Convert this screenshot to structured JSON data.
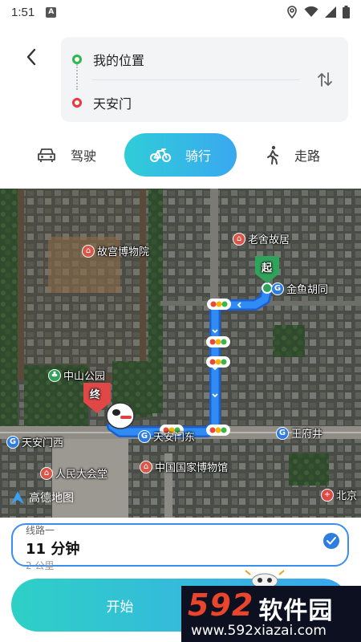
{
  "status_bar": {
    "time": "1:51",
    "notification_icon": "A",
    "icons": [
      "location-icon",
      "wifi-icon",
      "cellular-icon",
      "battery-icon"
    ]
  },
  "route": {
    "origin": "我的位置",
    "destination": "天安门"
  },
  "modes": [
    {
      "label": "驾驶",
      "icon": "car-icon",
      "selected": false
    },
    {
      "label": "骑行",
      "icon": "bicycle-icon",
      "selected": true
    },
    {
      "label": "走路",
      "icon": "walk-icon",
      "selected": false
    }
  ],
  "map": {
    "pois": [
      "故宫博物院",
      "老舍故居",
      "金鱼胡同",
      "中山公园",
      "天安门东",
      "王府井",
      "天安门西",
      "人民大会堂",
      "中国国家博物馆",
      "北京"
    ],
    "start_marker": "起",
    "end_marker": "终",
    "logo": "高德地图",
    "route_color": "#2f7de0"
  },
  "route_option": {
    "name": "线路一",
    "duration": "11 分钟",
    "distance": "2 公里",
    "selected": true
  },
  "start_button": {
    "label": "开始"
  },
  "watermark": {
    "brand_num": "592",
    "brand_text": "软件园",
    "url": "www.592xiazai.com"
  },
  "colors": {
    "accent_gradient_start": "#2fcdd8",
    "accent_gradient_end": "#3aa8f0",
    "origin_dot": "#2db84d",
    "dest_dot": "#e5393b"
  }
}
